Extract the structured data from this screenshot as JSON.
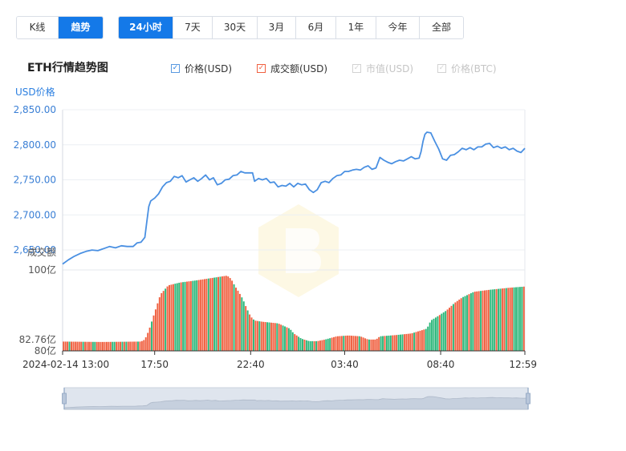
{
  "tabs_view": [
    {
      "label": "K线",
      "active": false
    },
    {
      "label": "趋势",
      "active": true
    }
  ],
  "tabs_range": [
    {
      "label": "24小时",
      "active": true
    },
    {
      "label": "7天",
      "active": false
    },
    {
      "label": "30天",
      "active": false
    },
    {
      "label": "3月",
      "active": false
    },
    {
      "label": "6月",
      "active": false
    },
    {
      "label": "1年",
      "active": false
    },
    {
      "label": "今年",
      "active": false
    },
    {
      "label": "全部",
      "active": false
    }
  ],
  "legend": [
    {
      "label": "价格(USD)",
      "checked": true,
      "color": "#4a90e2"
    },
    {
      "label": "成交额(USD)",
      "checked": true,
      "color": "#f06040"
    },
    {
      "label": "市值(USD)",
      "checked": false,
      "color": "#d2d2d2"
    },
    {
      "label": "价格(BTC)",
      "checked": false,
      "color": "#d2d2d2"
    }
  ],
  "chart_data": {
    "type": "line",
    "title": "ETH行情趋势图",
    "price_axis_label": "USD价格",
    "volume_axis_label": "成交额",
    "price_ticks": [
      "2,850.00",
      "2,800.00",
      "2,750.00",
      "2,700.00",
      "2,650.00"
    ],
    "price_ylim": [
      2637.5,
      2850
    ],
    "volume_ticks": [
      "100亿",
      "82.76亿",
      "80亿"
    ],
    "volume_ylim": [
      80,
      100
    ],
    "x_ticks": [
      "2024-02-14 13:00",
      "17:50",
      "22:40",
      "03:40",
      "08:40",
      "12:59"
    ],
    "price_color": "#4a90e2",
    "volume_up_color": "#f06040",
    "volume_down_color": "#2cb77a",
    "price_series": [
      [
        0,
        2630
      ],
      [
        3,
        2636
      ],
      [
        6,
        2641
      ],
      [
        9,
        2645
      ],
      [
        12,
        2648
      ],
      [
        15,
        2650
      ],
      [
        18,
        2649
      ],
      [
        21,
        2652
      ],
      [
        24,
        2655
      ],
      [
        27,
        2653
      ],
      [
        30,
        2656
      ],
      [
        33,
        2655
      ],
      [
        36,
        2655
      ],
      [
        38,
        2660
      ],
      [
        40,
        2661
      ],
      [
        42,
        2668
      ],
      [
        43,
        2690
      ],
      [
        44,
        2712
      ],
      [
        45,
        2720
      ],
      [
        47,
        2724
      ],
      [
        49,
        2730
      ],
      [
        51,
        2740
      ],
      [
        53,
        2746
      ],
      [
        55,
        2748
      ],
      [
        57,
        2755
      ],
      [
        59,
        2753
      ],
      [
        61,
        2756
      ],
      [
        63,
        2747
      ],
      [
        65,
        2750
      ],
      [
        67,
        2753
      ],
      [
        69,
        2748
      ],
      [
        71,
        2752
      ],
      [
        73,
        2757
      ],
      [
        75,
        2750
      ],
      [
        77,
        2753
      ],
      [
        79,
        2743
      ],
      [
        81,
        2745
      ],
      [
        83,
        2750
      ],
      [
        85,
        2751
      ],
      [
        87,
        2756
      ],
      [
        89,
        2757
      ],
      [
        91,
        2762
      ],
      [
        93,
        2760
      ],
      [
        95,
        2760
      ],
      [
        97,
        2760
      ],
      [
        98,
        2748
      ],
      [
        100,
        2752
      ],
      [
        102,
        2750
      ],
      [
        104,
        2752
      ],
      [
        106,
        2746
      ],
      [
        108,
        2747
      ],
      [
        110,
        2740
      ],
      [
        112,
        2742
      ],
      [
        114,
        2741
      ],
      [
        116,
        2745
      ],
      [
        118,
        2740
      ],
      [
        120,
        2745
      ],
      [
        122,
        2743
      ],
      [
        124,
        2744
      ],
      [
        126,
        2736
      ],
      [
        128,
        2732
      ],
      [
        130,
        2736
      ],
      [
        132,
        2746
      ],
      [
        134,
        2748
      ],
      [
        136,
        2746
      ],
      [
        138,
        2752
      ],
      [
        140,
        2756
      ],
      [
        142,
        2757
      ],
      [
        144,
        2762
      ],
      [
        146,
        2762
      ],
      [
        148,
        2764
      ],
      [
        150,
        2765
      ],
      [
        152,
        2764
      ],
      [
        154,
        2768
      ],
      [
        156,
        2770
      ],
      [
        158,
        2765
      ],
      [
        160,
        2767
      ],
      [
        162,
        2782
      ],
      [
        164,
        2778
      ],
      [
        166,
        2775
      ],
      [
        168,
        2773
      ],
      [
        170,
        2776
      ],
      [
        172,
        2778
      ],
      [
        174,
        2777
      ],
      [
        176,
        2780
      ],
      [
        178,
        2783
      ],
      [
        180,
        2780
      ],
      [
        182,
        2781
      ],
      [
        183,
        2790
      ],
      [
        184,
        2805
      ],
      [
        185,
        2815
      ],
      [
        186,
        2818
      ],
      [
        188,
        2817
      ],
      [
        190,
        2805
      ],
      [
        192,
        2794
      ],
      [
        194,
        2780
      ],
      [
        196,
        2778
      ],
      [
        198,
        2785
      ],
      [
        200,
        2786
      ],
      [
        202,
        2790
      ],
      [
        204,
        2795
      ],
      [
        206,
        2793
      ],
      [
        208,
        2796
      ],
      [
        210,
        2793
      ],
      [
        212,
        2797
      ],
      [
        214,
        2797
      ],
      [
        216,
        2801
      ],
      [
        218,
        2802
      ],
      [
        220,
        2796
      ],
      [
        222,
        2798
      ],
      [
        224,
        2795
      ],
      [
        226,
        2797
      ],
      [
        228,
        2793
      ],
      [
        230,
        2795
      ],
      [
        232,
        2791
      ],
      [
        234,
        2789
      ],
      [
        236,
        2795
      ]
    ],
    "volume_series": [
      [
        0,
        82.3
      ],
      [
        20,
        82.2
      ],
      [
        40,
        82.3
      ],
      [
        42,
        82.8
      ],
      [
        44,
        85.0
      ],
      [
        46,
        88.0
      ],
      [
        48,
        91.0
      ],
      [
        50,
        94.0
      ],
      [
        54,
        96.2
      ],
      [
        60,
        96.9
      ],
      [
        68,
        97.4
      ],
      [
        76,
        98.0
      ],
      [
        84,
        98.6
      ],
      [
        86,
        97.8
      ],
      [
        88,
        96.0
      ],
      [
        90,
        94.5
      ],
      [
        92,
        92.8
      ],
      [
        94,
        90.5
      ],
      [
        96,
        88.5
      ],
      [
        98,
        87.5
      ],
      [
        102,
        87.2
      ],
      [
        110,
        86.8
      ],
      [
        116,
        85.5
      ],
      [
        118,
        84.3
      ],
      [
        122,
        83.0
      ],
      [
        126,
        82.4
      ],
      [
        130,
        82.4
      ],
      [
        134,
        82.8
      ],
      [
        140,
        83.6
      ],
      [
        146,
        83.8
      ],
      [
        152,
        83.6
      ],
      [
        156,
        82.8
      ],
      [
        160,
        82.8
      ],
      [
        162,
        83.6
      ],
      [
        170,
        83.9
      ],
      [
        178,
        84.3
      ],
      [
        186,
        85.5
      ],
      [
        188,
        87.5
      ],
      [
        192,
        88.7
      ],
      [
        196,
        90.0
      ],
      [
        200,
        91.8
      ],
      [
        204,
        93.2
      ],
      [
        210,
        94.6
      ],
      [
        218,
        95.1
      ],
      [
        228,
        95.6
      ],
      [
        236,
        95.9
      ]
    ]
  }
}
